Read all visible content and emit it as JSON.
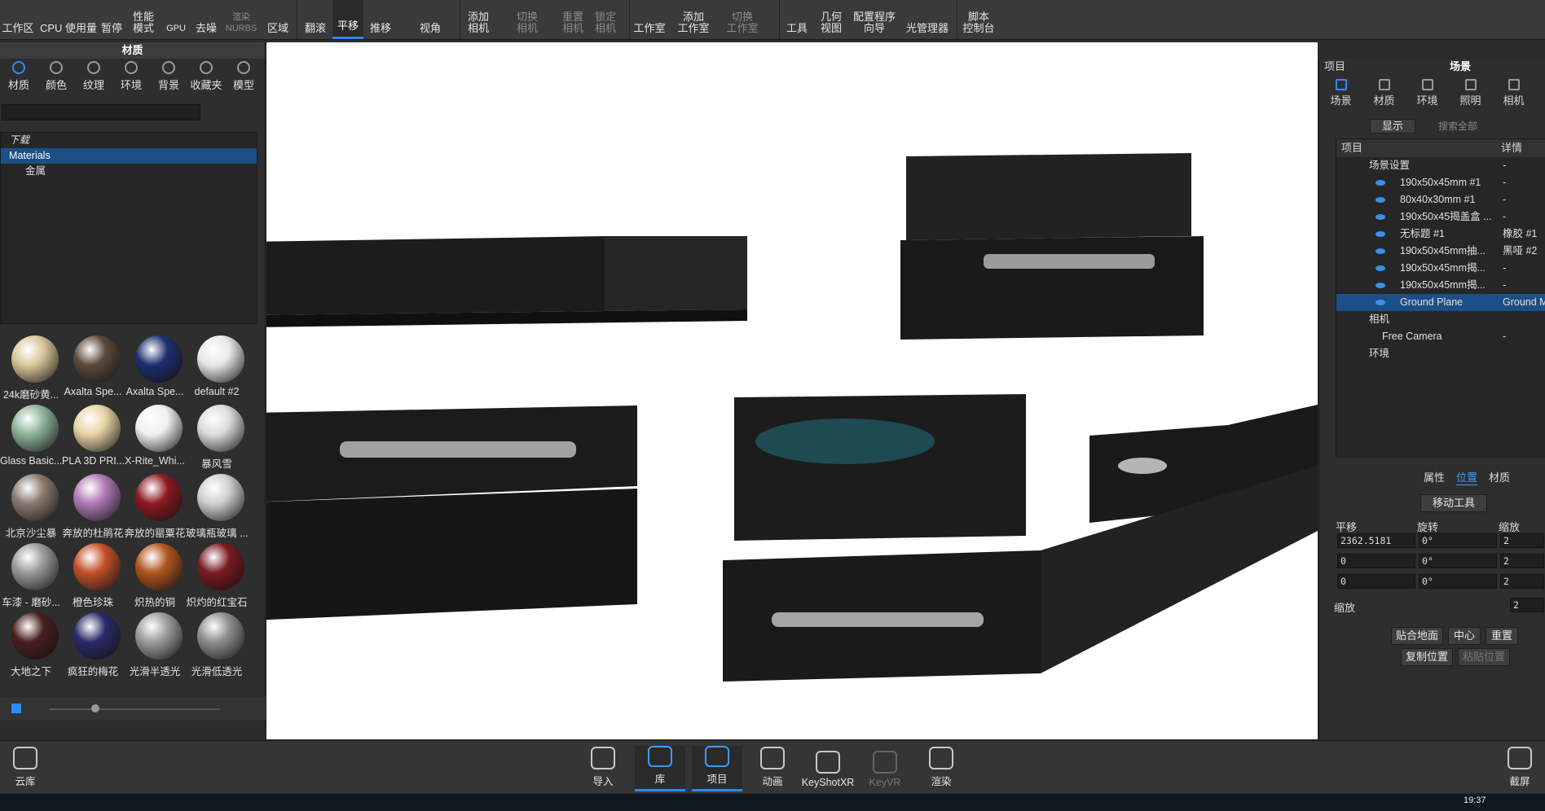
{
  "toolbar": {
    "items": [
      {
        "label": "工作区"
      },
      {
        "label": "CPU 使用量"
      },
      {
        "label": "暂停"
      },
      {
        "label": "性能\n模式"
      },
      {
        "label": "GPU"
      },
      {
        "label": "去噪"
      },
      {
        "label": "渲染\nNURBS"
      },
      {
        "label": "区域"
      },
      {
        "label": "翻滚"
      },
      {
        "label": "平移"
      },
      {
        "label": "推移"
      },
      {
        "label": "视角"
      },
      {
        "label": "添加\n相机"
      },
      {
        "label": "切换\n相机"
      },
      {
        "label": "重置\n相机"
      },
      {
        "label": "锁定\n相机"
      },
      {
        "label": "工作室"
      },
      {
        "label": "添加\n工作室"
      },
      {
        "label": "切换\n工作室"
      },
      {
        "label": "工具"
      },
      {
        "label": "几何\n视图"
      },
      {
        "label": "配置程序\n向导"
      },
      {
        "label": "光管理器"
      },
      {
        "label": "脚本\n控制台"
      }
    ]
  },
  "library": {
    "title": "材质",
    "tabs": [
      "材质",
      "颜色",
      "纹理",
      "环境",
      "背景",
      "收藏夹",
      "模型"
    ],
    "tree": [
      "下载",
      "Materials",
      "金属"
    ],
    "thumbnails": [
      {
        "label": "24k磨砂黄...",
        "color": "#d9c79a"
      },
      {
        "label": "Axalta Spe...",
        "color": "#5a4a3c"
      },
      {
        "label": "Axalta Spe...",
        "color": "#1d2f6e"
      },
      {
        "label": "default #2",
        "color": "#e8e8e8"
      },
      {
        "label": "Glass Basic...",
        "color": "#8fb39a"
      },
      {
        "label": "PLA 3D PRI...",
        "color": "#e8d3a5"
      },
      {
        "label": "X-Rite_Whi...",
        "color": "#f0f0f0"
      },
      {
        "label": "暴风雪",
        "color": "#dcdcdc"
      },
      {
        "label": "北京沙尘暴",
        "color": "#8a7a6e"
      },
      {
        "label": "奔放的杜鹃花",
        "color": "#b07ab5"
      },
      {
        "label": "奔放的罂粟花",
        "color": "#8c1a20"
      },
      {
        "label": "玻璃瓶玻璃 ...",
        "color": "#d0d0d0"
      },
      {
        "label": "车漆 - 磨砂...",
        "color": "#9a9a9a"
      },
      {
        "label": "橙色珍珠",
        "color": "#c4502a"
      },
      {
        "label": "炽热的铜",
        "color": "#b0551e"
      },
      {
        "label": "炽灼的红宝石",
        "color": "#7a1a22"
      },
      {
        "label": "大地之下",
        "color": "#4a1e1e"
      },
      {
        "label": "疯狂的梅花",
        "color": "#2a2a6a"
      },
      {
        "label": "光滑半透光",
        "color": "#9c9c9c"
      },
      {
        "label": "光滑低透光",
        "color": "#8e8e8e"
      }
    ]
  },
  "scene_panel": {
    "title_left": "项目",
    "title_main": "场景",
    "tabs": [
      "场景",
      "材质",
      "环境",
      "照明",
      "相机"
    ],
    "show_label": "显示",
    "search_placeholder": "搜索全部",
    "col_item": "项目",
    "col_detail": "详情",
    "rows": [
      {
        "name": "场景设置",
        "detail": "-"
      },
      {
        "name": "190x50x45mm #1",
        "detail": "-"
      },
      {
        "name": "80x40x30mm #1",
        "detail": "-"
      },
      {
        "name": "190x50x45揭盖盒 ...",
        "detail": "-"
      },
      {
        "name": "无标题 #1",
        "detail": "橡胶 #1"
      },
      {
        "name": "190x50x45mm抽...",
        "detail": "黑哑 #2"
      },
      {
        "name": "190x50x45mm揭...",
        "detail": "-"
      },
      {
        "name": "190x50x45mm揭...",
        "detail": "-"
      },
      {
        "name": "Ground Plane",
        "detail": "Ground M"
      },
      {
        "name": "相机",
        "detail": ""
      },
      {
        "name": "Free Camera",
        "detail": "-"
      },
      {
        "name": "环境",
        "detail": ""
      }
    ],
    "sub_tabs": [
      "属性",
      "位置",
      "材质"
    ],
    "move_tool": "移动工具",
    "labels": {
      "translate": "平移",
      "rotate": "旋转",
      "scale": "缩放",
      "uniform_scale": "缩放"
    },
    "x": "2362.5181",
    "y": "0",
    "z": "0",
    "rx": "0°",
    "ry": "0°",
    "rz": "0°",
    "sx": "2",
    "sy": "2",
    "sz": "2",
    "uniform": "2",
    "btn_snap": "贴合地面",
    "btn_center": "中心",
    "btn_reset": "重置",
    "btn_copy": "复制位置",
    "btn_paste": "粘贴位置"
  },
  "bottombar": {
    "cloud": "云库",
    "items": [
      "导入",
      "库",
      "项目",
      "动画",
      "KeyShotXR",
      "KeyVR",
      "渲染"
    ],
    "screenshot": "截屏"
  },
  "taskbar": {
    "time": "19:37"
  }
}
